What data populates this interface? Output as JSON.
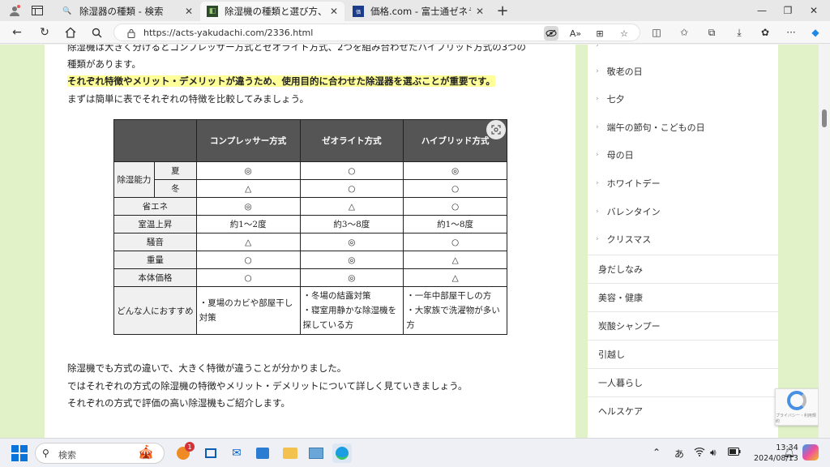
{
  "browser": {
    "tabs": [
      {
        "title": "除湿器の種類 - 検索",
        "favicon": "search-icon",
        "active": false
      },
      {
        "title": "除湿機の種類と選び方、種類別のメリット",
        "favicon": "site-icon",
        "active": true
      },
      {
        "title": "価格.com - 富士通ゼネラル ノクリア",
        "favicon": "kakaku-icon",
        "active": false
      }
    ],
    "url": "https://acts-yakudachi.com/2336.html"
  },
  "article": {
    "line1": "除湿機は大きく分けるとコンプレッサー方式とゼオライト方式、2つを組み合わせたハイブリッド方式の3つの",
    "line2": "種類があります。",
    "highlight": "それぞれ特徴やメリット・デメリットが違うため、使用目的に合わせた除湿器を選ぶことが重要です。",
    "line3": "まずは簡単に表でそれぞれの特徴を比較してみましょう。",
    "after1": "除湿機でも方式の違いで、大きく特徴が違うことが分かりました。",
    "after2": "ではそれぞれの方式の除湿機の特徴やメリット・デメリットについて詳しく見ていきましょう。",
    "after3": "それぞれの方式で評価の高い除湿機もご紹介します。"
  },
  "comparison_table": {
    "headers": [
      "コンプレッサー方式",
      "ゼオライト方式",
      "ハイブリッド方式"
    ],
    "dehum_label": "除湿能力",
    "summer_label": "夏",
    "winter_label": "冬",
    "summer": [
      "◎",
      "○",
      "◎"
    ],
    "winter": [
      "△",
      "○",
      "○"
    ],
    "rows": [
      {
        "label": "省エネ",
        "values": [
          "◎",
          "△",
          "○"
        ]
      },
      {
        "label": "室温上昇",
        "values": [
          "約1～2度",
          "約3～8度",
          "約1～8度"
        ]
      },
      {
        "label": "騒音",
        "values": [
          "△",
          "◎",
          "○"
        ]
      },
      {
        "label": "重量",
        "values": [
          "○",
          "◎",
          "△"
        ]
      },
      {
        "label": "本体価格",
        "values": [
          "○",
          "◎",
          "△"
        ]
      }
    ],
    "recommend_label": "どんな人におすすめ",
    "recommend": [
      [
        "・夏場のカビや部屋干し",
        "対策"
      ],
      [
        "・冬場の結露対策",
        "・寝室用静かな除湿機を",
        "探している方"
      ],
      [
        "・一年中部屋干しの方",
        "・大家族で洗濯物が多い",
        "方"
      ]
    ]
  },
  "sidebar": {
    "sub_items": [
      "敬老の日",
      "七夕",
      "端午の節句・こどもの日",
      "母の日",
      "ホワイトデー",
      "バレンタイン",
      "クリスマス"
    ],
    "top_items": [
      "身だしなみ",
      "美容・健康",
      "炭酸シャンプー",
      "引越し",
      "一人暮らし",
      "ヘルスケア"
    ]
  },
  "recaptcha": {
    "caption": "プライバシー・利用規約"
  },
  "taskbar": {
    "search_placeholder": "検索",
    "notification_count": "1",
    "ime": "あ",
    "time": "13:34",
    "date": "2024/08/13"
  }
}
